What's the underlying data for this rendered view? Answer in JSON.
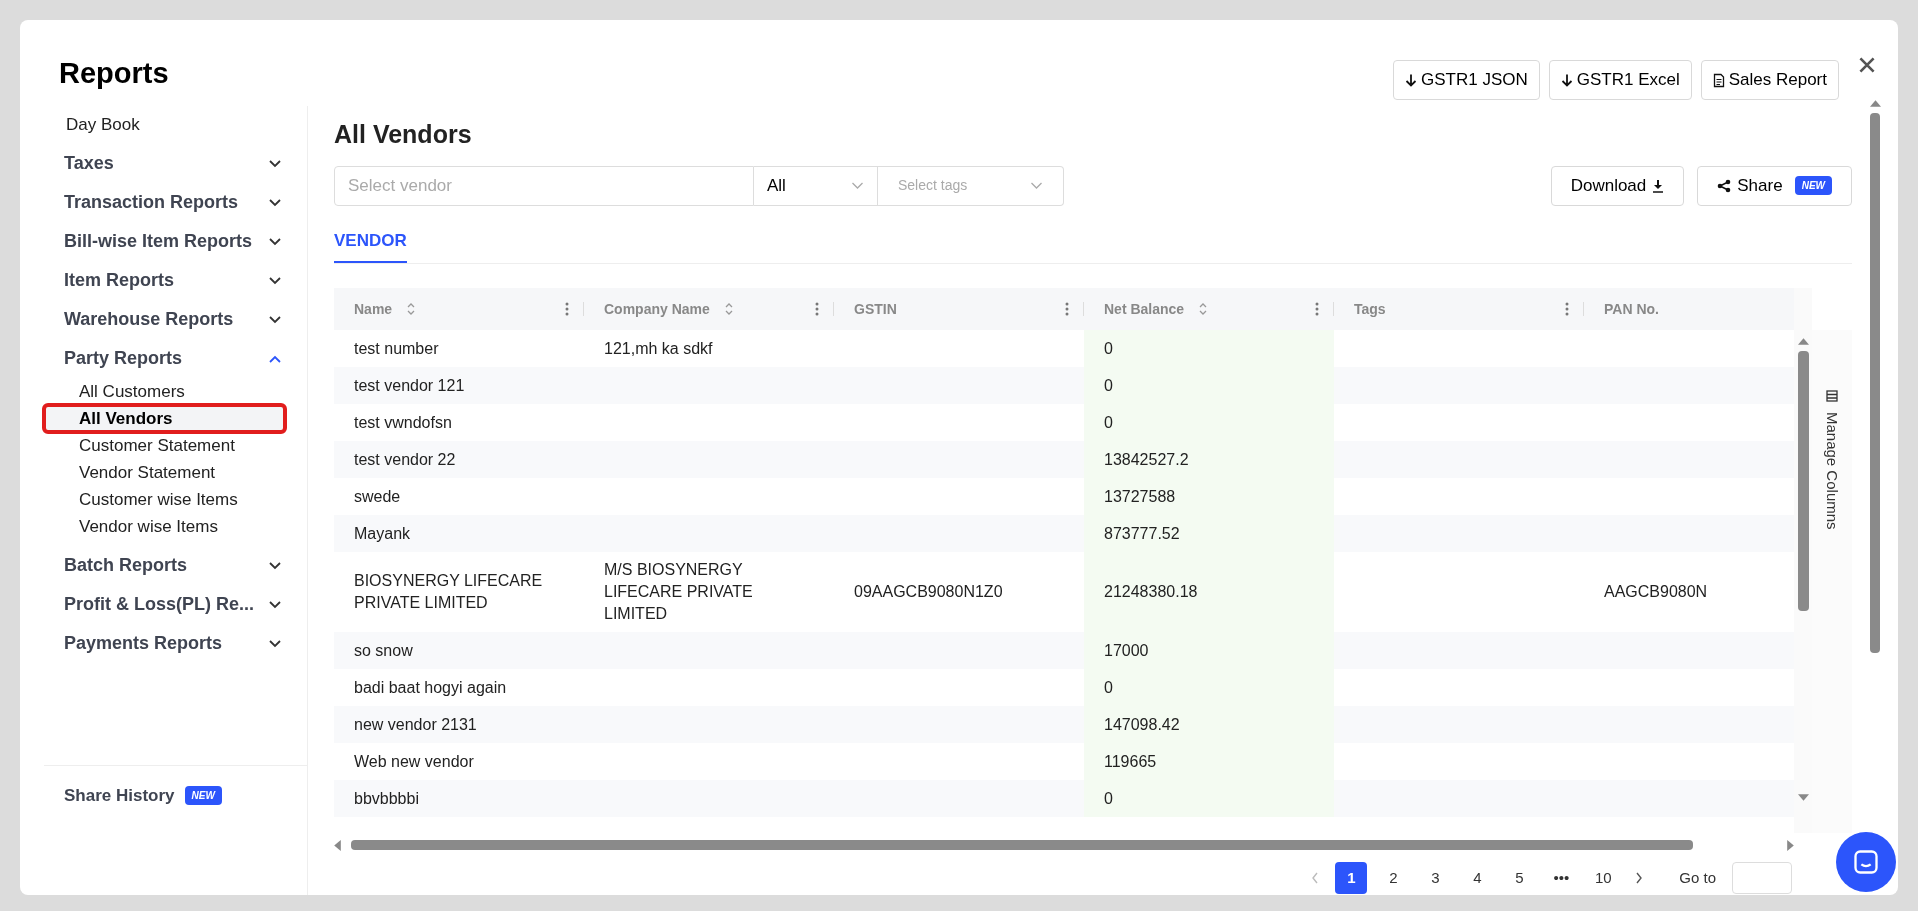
{
  "modal": {
    "title": "Reports",
    "header_buttons": [
      {
        "label": "GSTR1 JSON"
      },
      {
        "label": "GSTR1 Excel"
      },
      {
        "label": "Sales Report"
      }
    ]
  },
  "sidebar": {
    "items": [
      {
        "kind": "link",
        "label": "Day Book",
        "selected": false
      },
      {
        "kind": "group",
        "label": "Taxes",
        "expanded": false
      },
      {
        "kind": "group",
        "label": "Transaction Reports",
        "expanded": false
      },
      {
        "kind": "group",
        "label": "Bill-wise Item Reports",
        "expanded": false
      },
      {
        "kind": "group",
        "label": "Item Reports",
        "expanded": false
      },
      {
        "kind": "group",
        "label": "Warehouse Reports",
        "expanded": false
      },
      {
        "kind": "group",
        "label": "Party Reports",
        "expanded": true,
        "children": [
          {
            "label": "All Customers",
            "selected": false
          },
          {
            "label": "All Vendors",
            "selected": true
          },
          {
            "label": "Customer Statement",
            "selected": false
          },
          {
            "label": "Vendor Statement",
            "selected": false
          },
          {
            "label": "Customer wise Items",
            "selected": false
          },
          {
            "label": "Vendor wise Items",
            "selected": false
          }
        ]
      },
      {
        "kind": "group",
        "label": "Batch Reports",
        "expanded": false
      },
      {
        "kind": "group",
        "label": "Profit & Loss(PL) Re...",
        "expanded": false
      },
      {
        "kind": "group",
        "label": "Payments Reports",
        "expanded": false
      }
    ],
    "footer": {
      "label": "Share History",
      "badge": "NEW"
    }
  },
  "content": {
    "title": "All Vendors",
    "filters": {
      "vendor": {
        "placeholder": "Select vendor"
      },
      "type": {
        "value": "All"
      },
      "tags": {
        "placeholder": "Select tags"
      }
    },
    "actions": [
      {
        "label": "Download"
      },
      {
        "label": "Share",
        "badge": "NEW"
      }
    ],
    "tabs": [
      {
        "label": "VENDOR",
        "selected": true
      }
    ],
    "table": {
      "columns": [
        {
          "label": "Name",
          "sortable": true,
          "menu": true,
          "highlighted": false
        },
        {
          "label": "Company Name",
          "sortable": true,
          "menu": true,
          "highlighted": false
        },
        {
          "label": "GSTIN",
          "sortable": false,
          "menu": true,
          "highlighted": false
        },
        {
          "label": "Net Balance",
          "sortable": true,
          "menu": true,
          "highlighted": true
        },
        {
          "label": "Tags",
          "sortable": false,
          "menu": true,
          "highlighted": false
        },
        {
          "label": "PAN No.",
          "sortable": false,
          "menu": false,
          "highlighted": false
        }
      ],
      "rows": [
        {
          "cells": [
            "test number",
            "121,mh ka sdkf",
            null,
            "0",
            null,
            null
          ]
        },
        {
          "cells": [
            "test vendor 121",
            null,
            null,
            "0",
            null,
            null
          ]
        },
        {
          "cells": [
            "test vwndofsn",
            null,
            null,
            "0",
            null,
            null
          ]
        },
        {
          "cells": [
            "test vendor 22",
            null,
            null,
            "13842527.2",
            null,
            null
          ]
        },
        {
          "cells": [
            "swede",
            null,
            null,
            "13727588",
            null,
            null
          ]
        },
        {
          "cells": [
            "Mayank",
            null,
            null,
            "873777.52",
            null,
            null
          ]
        },
        {
          "cells": [
            "BIOSYNERGY LIFECARE PRIVATE LIMITED",
            "M/S BIOSYNERGY LIFECARE PRIVATE LIMITED",
            "09AAGCB9080N1Z0",
            "21248380.18",
            null,
            "AAGCB9080N"
          ]
        },
        {
          "cells": [
            "so snow",
            null,
            null,
            "17000",
            null,
            null
          ]
        },
        {
          "cells": [
            "badi baat hogyi again",
            null,
            null,
            "0",
            null,
            null
          ]
        },
        {
          "cells": [
            "new vendor 2131",
            null,
            null,
            "147098.42",
            null,
            null
          ]
        },
        {
          "cells": [
            "Web new vendor",
            null,
            null,
            "119665",
            null,
            null
          ]
        },
        {
          "cells": [
            "bbvbbbbi",
            null,
            null,
            "0",
            null,
            null
          ]
        }
      ],
      "side_panel": {
        "label": "Manage Columns"
      }
    },
    "pagination": {
      "pages": [
        {
          "label": "1",
          "selected": true
        },
        {
          "label": "2",
          "selected": false
        },
        {
          "label": "3",
          "selected": false
        },
        {
          "label": "4",
          "selected": false
        },
        {
          "label": "5",
          "selected": false
        },
        {
          "label": "•••",
          "selected": false
        },
        {
          "label": "10",
          "selected": false
        }
      ],
      "goto_label": "Go to"
    }
  }
}
